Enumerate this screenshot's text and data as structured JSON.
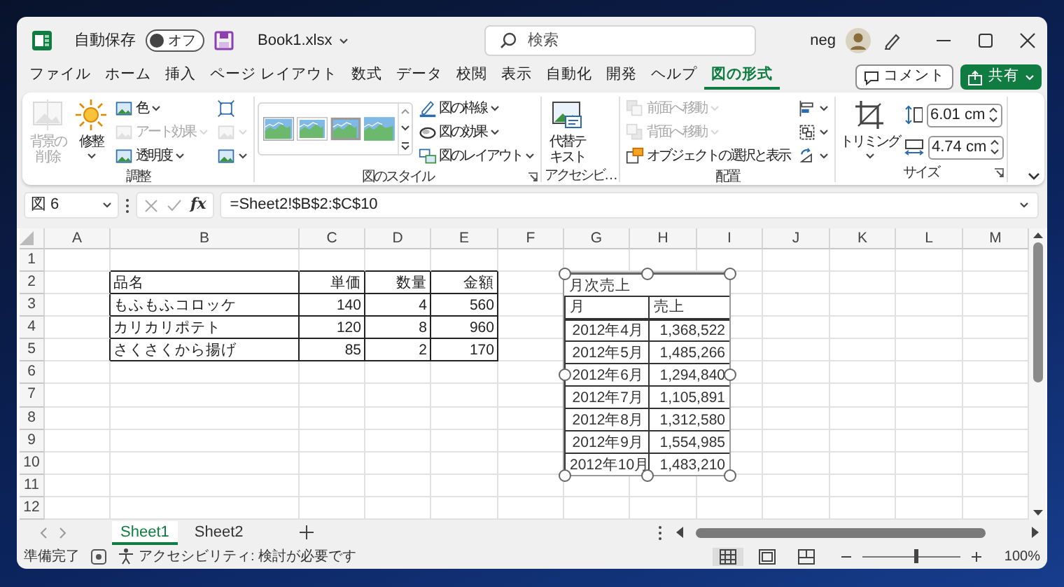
{
  "window": {
    "autosave_label": "自動保存",
    "autosave": {
      "label": "オフ",
      "on": false
    },
    "file_name": "Book1.xlsx",
    "search_placeholder": "検索",
    "user": "neg"
  },
  "menu_tabs": [
    {
      "label": "ファイル",
      "selected": false
    },
    {
      "label": "ホーム",
      "selected": false
    },
    {
      "label": "挿入",
      "selected": false
    },
    {
      "label": "ページ レイアウト",
      "selected": false
    },
    {
      "label": "数式",
      "selected": false
    },
    {
      "label": "データ",
      "selected": false
    },
    {
      "label": "校閲",
      "selected": false
    },
    {
      "label": "表示",
      "selected": false
    },
    {
      "label": "自動化",
      "selected": false
    },
    {
      "label": "開発",
      "selected": false
    },
    {
      "label": "ヘルプ",
      "selected": false
    },
    {
      "label": "図の形式",
      "selected": true
    }
  ],
  "comment_button": "コメント",
  "share_button": "共有",
  "ribbon": [
    {
      "label": "調整",
      "launcher": false,
      "blocks": [
        {
          "kind": "large",
          "label": "背景の削除",
          "caret": false,
          "disabled": true
        },
        {
          "kind": "large",
          "label": "修整",
          "caret": true,
          "disabled": false
        },
        {
          "kind": "stack",
          "buttons": [
            {
              "label": "色",
              "caret": true,
              "disabled": false
            },
            {
              "label": "アート効果",
              "caret": true,
              "disabled": true
            },
            {
              "label": "透明度",
              "caret": true,
              "disabled": false
            }
          ]
        },
        {
          "kind": "stack",
          "buttons": [
            {
              "caret": false,
              "disabled": false
            },
            {
              "caret": true,
              "disabled": true
            },
            {
              "caret": true,
              "disabled": false
            }
          ]
        }
      ]
    },
    {
      "label": "図のスタイル",
      "launcher": true,
      "blocks": [
        {
          "kind": "gallery",
          "styles": [
            {
              "kind": "frame"
            },
            {
              "kind": "white"
            },
            {
              "kind": "shadow"
            },
            {
              "kind": "soft"
            }
          ]
        },
        {
          "kind": "stack",
          "buttons": [
            {
              "label": "図の枠線",
              "caret": true,
              "disabled": false
            },
            {
              "label": "図の効果",
              "caret": true,
              "disabled": false
            },
            {
              "label": "図のレイアウト",
              "caret": true,
              "disabled": false
            }
          ]
        }
      ]
    },
    {
      "label": "アクセシビ…",
      "launcher": false,
      "blocks": [
        {
          "kind": "large",
          "label": "代替テキスト",
          "caret": false,
          "disabled": false
        }
      ]
    },
    {
      "label": "配置",
      "launcher": false,
      "blocks": [
        {
          "kind": "stack",
          "buttons": [
            {
              "label": "前面へ移動",
              "caret": true,
              "disabled": true
            },
            {
              "label": "背面へ移動",
              "caret": true,
              "disabled": true
            },
            {
              "label": "オブジェクトの選択と表示",
              "caret": false,
              "disabled": false
            }
          ]
        },
        {
          "kind": "stack",
          "buttons": [
            {
              "caret": true,
              "disabled": false
            },
            {
              "caret": true,
              "disabled": false
            },
            {
              "caret": true,
              "disabled": false
            }
          ]
        }
      ]
    },
    {
      "label": "サイズ",
      "launcher": true,
      "blocks": [
        {
          "kind": "split",
          "label": "トリミング",
          "caret": true,
          "disabled": false
        },
        {
          "kind": "spin",
          "fields": [
            {
              "value": "6.01 cm"
            },
            {
              "value": "4.74 cm"
            }
          ]
        }
      ]
    }
  ],
  "formula_bar": {
    "name_box": "図 6",
    "function_button": "fx",
    "formula": "=Sheet2!$B$2:$C$10"
  },
  "columns": [
    "A",
    "B",
    "C",
    "D",
    "E",
    "F",
    "G",
    "H",
    "I",
    "J",
    "K",
    "L",
    "M"
  ],
  "rows": [
    "1",
    "2",
    "3",
    "4",
    "5",
    "6",
    "7",
    "8",
    "9",
    "10",
    "11",
    "12"
  ],
  "table": {
    "header": [
      "品名",
      "単価",
      "数量",
      "金額"
    ],
    "rows": [
      [
        "もふもふコロッケ",
        "140",
        "4",
        "560"
      ],
      [
        "カリカリポテト",
        "120",
        "8",
        "960"
      ],
      [
        "さくさくから揚げ",
        "85",
        "2",
        "170"
      ]
    ]
  },
  "linked_picture": {
    "selected": true,
    "title": "月次売上",
    "header": [
      "月",
      "売上"
    ],
    "rows": [
      [
        "2012年4月",
        "1,368,522"
      ],
      [
        "2012年5月",
        "1,485,266"
      ],
      [
        "2012年6月",
        "1,294,840"
      ],
      [
        "2012年7月",
        "1,105,891"
      ],
      [
        "2012年8月",
        "1,312,580"
      ],
      [
        "2012年9月",
        "1,554,985"
      ],
      [
        "2012年10月",
        "1,483,210"
      ]
    ]
  },
  "sheet_tabs": [
    {
      "label": "Sheet1",
      "selected": true
    },
    {
      "label": "Sheet2",
      "selected": false
    }
  ],
  "status_bar": {
    "status": "準備完了",
    "accessibility": "アクセシビリティ: 検討が必要です",
    "views": [
      {
        "selected": true
      },
      {
        "selected": false
      },
      {
        "selected": false
      }
    ],
    "zoom": {
      "level": 0.54,
      "label": "100%"
    }
  }
}
